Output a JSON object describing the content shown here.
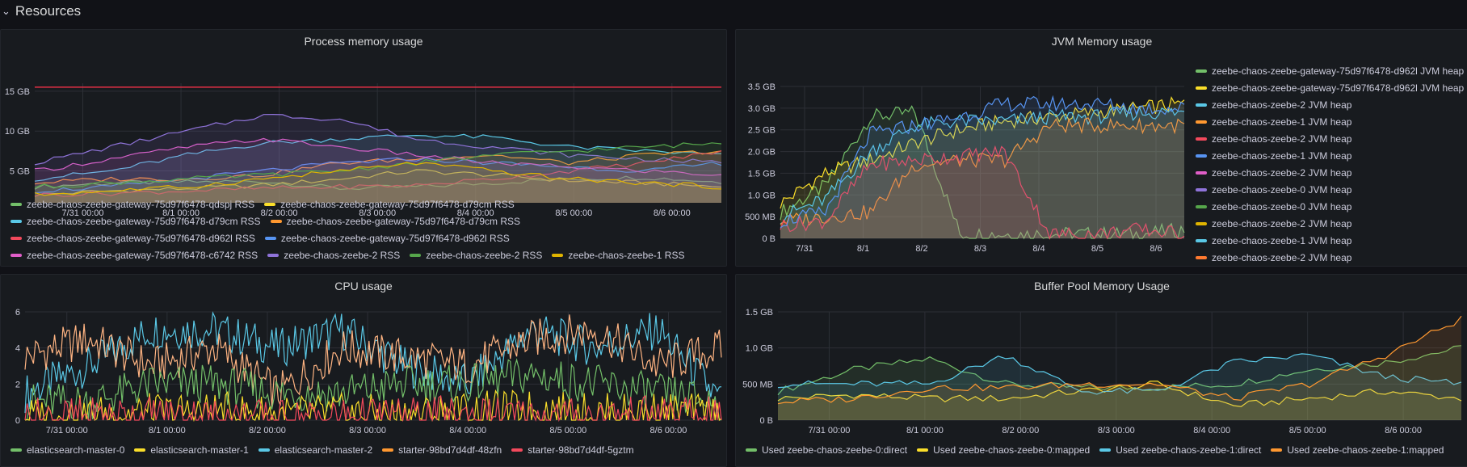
{
  "row": {
    "title": "Resources",
    "collapse_icon": "chevron-down-icon"
  },
  "panels": {
    "process_memory": {
      "title": "Process memory usage",
      "legend": [
        {
          "label": "zeebe-chaos-zeebe-gateway-75d97f6478-qdspj RSS",
          "color": "#73bf69"
        },
        {
          "label": "zeebe-chaos-zeebe-gateway-75d97f6478-d79cm RSS",
          "color": "#fade2a"
        },
        {
          "label": "zeebe-chaos-zeebe-gateway-75d97f6478-d79cm RSS",
          "color": "#5ac8e6"
        },
        {
          "label": "zeebe-chaos-zeebe-gateway-75d97f6478-d79cm RSS",
          "color": "#ff9830"
        },
        {
          "label": "zeebe-chaos-zeebe-gateway-75d97f6478-d962l RSS",
          "color": "#f2495c"
        },
        {
          "label": "zeebe-chaos-zeebe-gateway-75d97f6478-d962l RSS",
          "color": "#5794f2"
        },
        {
          "label": "zeebe-chaos-zeebe-gateway-75d97f6478-c6742 RSS",
          "color": "#e05ec8"
        },
        {
          "label": "zeebe-chaos-zeebe-2 RSS",
          "color": "#8f73d9"
        },
        {
          "label": "zeebe-chaos-zeebe-2 RSS",
          "color": "#56a64b"
        },
        {
          "label": "zeebe-chaos-zeebe-1 RSS",
          "color": "#e0b400"
        }
      ]
    },
    "jvm_memory": {
      "title": "JVM Memory usage",
      "legend": [
        {
          "label": "zeebe-chaos-zeebe-gateway-75d97f6478-d962l JVM heap",
          "color": "#73bf69"
        },
        {
          "label": "zeebe-chaos-zeebe-gateway-75d97f6478-d962l JVM heap",
          "color": "#fade2a"
        },
        {
          "label": "zeebe-chaos-zeebe-2 JVM heap",
          "color": "#5ac8e6"
        },
        {
          "label": "zeebe-chaos-zeebe-1 JVM heap",
          "color": "#ff9830"
        },
        {
          "label": "zeebe-chaos-zeebe-2 JVM heap",
          "color": "#f2495c"
        },
        {
          "label": "zeebe-chaos-zeebe-1 JVM heap",
          "color": "#5794f2"
        },
        {
          "label": "zeebe-chaos-zeebe-2 JVM heap",
          "color": "#e05ec8"
        },
        {
          "label": "zeebe-chaos-zeebe-0 JVM heap",
          "color": "#8f73d9"
        },
        {
          "label": "zeebe-chaos-zeebe-0 JVM heap",
          "color": "#56a64b"
        },
        {
          "label": "zeebe-chaos-zeebe-2 JVM heap",
          "color": "#e0b400"
        },
        {
          "label": "zeebe-chaos-zeebe-1 JVM heap",
          "color": "#5ac8e6"
        },
        {
          "label": "zeebe-chaos-zeebe-2 JVM heap",
          "color": "#ff7a30"
        }
      ]
    },
    "cpu": {
      "title": "CPU usage",
      "legend": [
        {
          "label": "elasticsearch-master-0",
          "color": "#73bf69"
        },
        {
          "label": "elasticsearch-master-1",
          "color": "#fade2a"
        },
        {
          "label": "elasticsearch-master-2",
          "color": "#5ac8e6"
        },
        {
          "label": "starter-98bd7d4df-48zfn",
          "color": "#ff9830"
        },
        {
          "label": "starter-98bd7d4df-5gztm",
          "color": "#f2495c"
        }
      ]
    },
    "buffer_pool": {
      "title": "Buffer Pool Memory Usage",
      "legend": [
        {
          "label": "Used zeebe-chaos-zeebe-0:direct",
          "color": "#73bf69"
        },
        {
          "label": "Used zeebe-chaos-zeebe-0:mapped",
          "color": "#fade2a"
        },
        {
          "label": "Used zeebe-chaos-zeebe-1:direct",
          "color": "#5ac8e6"
        },
        {
          "label": "Used zeebe-chaos-zeebe-1:mapped",
          "color": "#ff9830"
        }
      ]
    }
  },
  "chart_data": [
    {
      "type": "area",
      "title": "Process memory usage",
      "x_ticks": [
        "7/31 00:00",
        "8/1 00:00",
        "8/2 00:00",
        "8/3 00:00",
        "8/4 00:00",
        "8/5 00:00",
        "8/6 00:00"
      ],
      "y_ticks": [
        "5 GB",
        "10 GB",
        "15 GB"
      ],
      "ylim": [
        1,
        16
      ],
      "threshold_line": 15.5,
      "series": [
        {
          "name": "zeebe-chaos-zeebe-gateway-75d97f6478-qdspj RSS",
          "values": [
            3,
            3.5,
            3.6,
            3.7,
            2.8,
            3,
            3.5,
            4,
            4.2,
            3.6
          ]
        },
        {
          "name": "zeebe-chaos-zeebe-gateway-75d97f6478-d79cm RSS",
          "values": [
            2,
            2.5,
            2.8,
            3.2,
            4,
            5,
            4.5,
            3.8,
            3.5,
            3
          ]
        },
        {
          "name": "zeebe-chaos-zeebe-gateway-75d97f6478-d79cm RSS",
          "values": [
            4,
            5,
            7,
            8.5,
            9,
            9.5,
            9.2,
            8,
            7.5,
            7
          ]
        },
        {
          "name": "zeebe-chaos-zeebe-gateway-75d97f6478-d79cm RSS",
          "values": [
            3.5,
            4,
            4,
            4.5,
            6,
            6.5,
            7,
            6,
            7,
            7.5
          ]
        },
        {
          "name": "zeebe-chaos-zeebe-gateway-75d97f6478-d962l RSS",
          "values": [
            2,
            2.2,
            2.5,
            2.8,
            3,
            3.2,
            4,
            5,
            6,
            7.5
          ]
        },
        {
          "name": "zeebe-chaos-zeebe-gateway-75d97f6478-d962l RSS",
          "values": [
            2.5,
            3,
            4,
            5,
            6,
            6.5,
            6,
            5.5,
            5,
            6
          ]
        },
        {
          "name": "zeebe-chaos-zeebe-gateway-75d97f6478-c6742 RSS",
          "values": [
            5,
            6.5,
            8,
            9,
            8,
            7,
            6,
            5.5,
            5,
            4.5
          ]
        },
        {
          "name": "zeebe-chaos-zeebe-2 RSS",
          "values": [
            6,
            8,
            10,
            12,
            11.5,
            9,
            8,
            7,
            6.5,
            6
          ]
        },
        {
          "name": "zeebe-chaos-zeebe-2 RSS",
          "values": [
            3,
            3.5,
            4,
            4.5,
            5,
            6,
            7,
            7.5,
            8,
            8.5
          ]
        },
        {
          "name": "zeebe-chaos-zeebe-1 RSS",
          "values": [
            2,
            2.5,
            3,
            4,
            5,
            6,
            5,
            4,
            3.5,
            3
          ]
        }
      ]
    },
    {
      "type": "area",
      "title": "JVM Memory usage",
      "x_ticks": [
        "7/31",
        "8/1",
        "8/2",
        "8/3",
        "8/4",
        "8/5",
        "8/6"
      ],
      "y_ticks": [
        "0 B",
        "500 MB",
        "1.0 GB",
        "1.5 GB",
        "2.0 GB",
        "2.5 GB",
        "3.0 GB",
        "3.5 GB"
      ],
      "ylim": [
        0,
        3.5
      ],
      "series": [
        {
          "name": "zeebe-chaos-zeebe-gateway-75d97f6478-d962l JVM heap",
          "values": [
            0.6,
            1.2,
            2.8,
            2.9,
            0.1,
            0.1,
            0.1,
            0.1,
            0.1,
            0.2
          ]
        },
        {
          "name": "zeebe-chaos-zeebe-2 JVM heap",
          "values": [
            0.8,
            1.5,
            1.8,
            2.2,
            2.5,
            2.7,
            2.8,
            2.9,
            3.0,
            3.1
          ]
        },
        {
          "name": "zeebe-chaos-zeebe-1 JVM heap",
          "values": [
            0.5,
            0.9,
            2.0,
            2.6,
            2.7,
            2.7,
            2.8,
            2.8,
            2.9,
            2.9
          ]
        },
        {
          "name": "zeebe-chaos-zeebe-2 JVM heap",
          "values": [
            0.4,
            0.5,
            0.6,
            1.7,
            1.8,
            1.8,
            2.6,
            2.6,
            2.6,
            2.6
          ]
        },
        {
          "name": "zeebe-chaos-zeebe-1 JVM heap",
          "values": [
            0.3,
            0.4,
            1.7,
            1.8,
            1.9,
            2.0,
            0.1,
            0.1,
            0.2,
            0.1
          ]
        },
        {
          "name": "zeebe-chaos-zeebe-2 JVM heap",
          "values": [
            0.4,
            0.6,
            2.4,
            2.6,
            2.8,
            3.1,
            3.1,
            3.1,
            3.0,
            3.0
          ]
        }
      ]
    },
    {
      "type": "line",
      "title": "CPU usage",
      "x_ticks": [
        "7/31 00:00",
        "8/1 00:00",
        "8/2 00:00",
        "8/3 00:00",
        "8/4 00:00",
        "8/5 00:00",
        "8/6 00:00"
      ],
      "y_ticks": [
        "0",
        "2",
        "4",
        "6"
      ],
      "ylim": [
        0,
        6
      ],
      "series": [
        {
          "name": "elasticsearch-master-2",
          "values": [
            1.5,
            3,
            5,
            5,
            4,
            5,
            3,
            2,
            5,
            4,
            5,
            1
          ]
        },
        {
          "name": "starter-98bd7d4df-48zfn",
          "values": [
            3.5,
            4.5,
            3,
            4,
            1.5,
            4,
            3.5,
            3,
            4.5,
            5,
            3,
            4
          ]
        },
        {
          "name": "elasticsearch-master-0",
          "values": [
            1,
            1,
            2,
            2,
            1.5,
            1.5,
            2,
            2,
            2.5,
            2,
            1.5,
            1
          ]
        },
        {
          "name": "elasticsearch-master-1",
          "values": [
            0.2,
            0.3,
            0.4,
            0.5,
            0.3,
            0.4,
            0.3,
            0.5,
            0.6,
            0.4,
            0.5,
            0.3
          ]
        },
        {
          "name": "starter-98bd7d4df-5gztm",
          "values": [
            0.2,
            0.2,
            0.3,
            0.2,
            0.1,
            0.2,
            0.2,
            0.3,
            0.2,
            0.2,
            0.3,
            0.2
          ]
        }
      ]
    },
    {
      "type": "area",
      "title": "Buffer Pool Memory Usage",
      "x_ticks": [
        "7/31 00:00",
        "8/1 00:00",
        "8/2 00:00",
        "8/3 00:00",
        "8/4 00:00",
        "8/5 00:00",
        "8/6 00:00"
      ],
      "y_ticks": [
        "0 B",
        "500 MB",
        "1.0 GB",
        "1.5 GB"
      ],
      "ylim": [
        0,
        1.5
      ],
      "series": [
        {
          "name": "Used zeebe-chaos-zeebe-0:direct",
          "values": [
            0.4,
            0.7,
            0.85,
            0.5,
            0.45,
            0.45,
            0.5,
            0.7,
            0.8,
            1.0
          ]
        },
        {
          "name": "Used zeebe-chaos-zeebe-0:mapped",
          "values": [
            0.3,
            0.35,
            0.3,
            0.3,
            0.4,
            0.5,
            0.2,
            0.3,
            0.4,
            0.3
          ]
        },
        {
          "name": "Used zeebe-chaos-zeebe-1:direct",
          "values": [
            0.5,
            0.5,
            0.5,
            0.9,
            0.4,
            0.4,
            0.8,
            0.9,
            0.6,
            0.5
          ]
        },
        {
          "name": "Used zeebe-chaos-zeebe-1:mapped",
          "values": [
            0.25,
            0.3,
            0.45,
            0.45,
            0.5,
            0.5,
            0.3,
            0.5,
            0.9,
            1.4
          ]
        }
      ]
    }
  ]
}
